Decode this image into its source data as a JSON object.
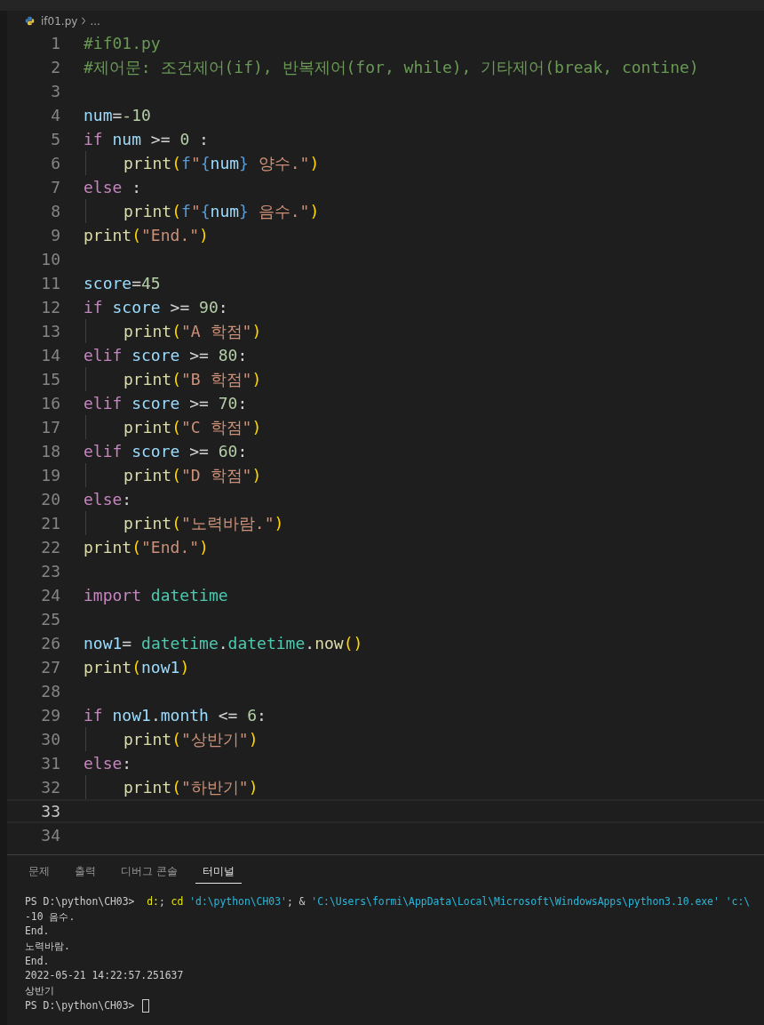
{
  "breadcrumb": {
    "file": "if01.py",
    "more": "..."
  },
  "code_lines": [
    {
      "number": "1",
      "indented": false,
      "current": false,
      "tokens": [
        {
          "kind": "comment",
          "text": "#if01.py"
        }
      ]
    },
    {
      "number": "2",
      "indented": false,
      "current": false,
      "tokens": [
        {
          "kind": "comment",
          "text": "#제어문: 조건제어(if), 반복제어(for, while), 기타제어(break, contine)"
        }
      ]
    },
    {
      "number": "3",
      "indented": false,
      "current": false
    },
    {
      "number": "4",
      "indented": false,
      "current": false,
      "tokens": [
        {
          "kind": "var",
          "text": "num"
        },
        {
          "kind": "op",
          "text": "="
        },
        {
          "kind": "num",
          "text": "-10"
        }
      ]
    },
    {
      "number": "5",
      "indented": false,
      "current": false,
      "tokens": [
        {
          "kind": "kw",
          "text": "if "
        },
        {
          "kind": "var",
          "text": "num"
        },
        {
          "kind": "op",
          "text": " >= "
        },
        {
          "kind": "num",
          "text": "0"
        },
        {
          "kind": "op",
          "text": " :"
        }
      ]
    },
    {
      "number": "6",
      "indented": true,
      "current": false,
      "tokens": [
        {
          "kind": "func",
          "text": "print"
        },
        {
          "kind": "brace",
          "text": "("
        },
        {
          "kind": "fprefix",
          "text": "f"
        },
        {
          "kind": "str",
          "text": "\""
        },
        {
          "kind": "fprefix",
          "text": "{"
        },
        {
          "kind": "var",
          "text": "num"
        },
        {
          "kind": "fprefix",
          "text": "}"
        },
        {
          "kind": "str",
          "text": " 양수.\""
        },
        {
          "kind": "brace",
          "text": ")"
        }
      ]
    },
    {
      "number": "7",
      "indented": false,
      "current": false,
      "tokens": [
        {
          "kind": "kw",
          "text": "else"
        },
        {
          "kind": "op",
          "text": " :"
        }
      ]
    },
    {
      "number": "8",
      "indented": true,
      "current": false,
      "tokens": [
        {
          "kind": "func",
          "text": "print"
        },
        {
          "kind": "brace",
          "text": "("
        },
        {
          "kind": "fprefix",
          "text": "f"
        },
        {
          "kind": "str",
          "text": "\""
        },
        {
          "kind": "fprefix",
          "text": "{"
        },
        {
          "kind": "var",
          "text": "num"
        },
        {
          "kind": "fprefix",
          "text": "}"
        },
        {
          "kind": "str",
          "text": " 음수.\""
        },
        {
          "kind": "brace",
          "text": ")"
        }
      ]
    },
    {
      "number": "9",
      "indented": false,
      "current": false,
      "tokens": [
        {
          "kind": "func",
          "text": "print"
        },
        {
          "kind": "brace",
          "text": "("
        },
        {
          "kind": "str",
          "text": "\"End.\""
        },
        {
          "kind": "brace",
          "text": ")"
        }
      ]
    },
    {
      "number": "10",
      "indented": false,
      "current": false
    },
    {
      "number": "11",
      "indented": false,
      "current": false,
      "tokens": [
        {
          "kind": "var",
          "text": "score"
        },
        {
          "kind": "op",
          "text": "="
        },
        {
          "kind": "num",
          "text": "45"
        }
      ]
    },
    {
      "number": "12",
      "indented": false,
      "current": false,
      "tokens": [
        {
          "kind": "kw",
          "text": "if "
        },
        {
          "kind": "var",
          "text": "score"
        },
        {
          "kind": "op",
          "text": " >= "
        },
        {
          "kind": "num",
          "text": "90"
        },
        {
          "kind": "op",
          "text": ":"
        }
      ]
    },
    {
      "number": "13",
      "indented": true,
      "current": false,
      "tokens": [
        {
          "kind": "func",
          "text": "print"
        },
        {
          "kind": "brace",
          "text": "("
        },
        {
          "kind": "str",
          "text": "\"A 학점\""
        },
        {
          "kind": "brace",
          "text": ")"
        }
      ]
    },
    {
      "number": "14",
      "indented": false,
      "current": false,
      "tokens": [
        {
          "kind": "kw",
          "text": "elif "
        },
        {
          "kind": "var",
          "text": "score"
        },
        {
          "kind": "op",
          "text": " >= "
        },
        {
          "kind": "num",
          "text": "80"
        },
        {
          "kind": "op",
          "text": ":"
        }
      ]
    },
    {
      "number": "15",
      "indented": true,
      "current": false,
      "tokens": [
        {
          "kind": "func",
          "text": "print"
        },
        {
          "kind": "brace",
          "text": "("
        },
        {
          "kind": "str",
          "text": "\"B 학점\""
        },
        {
          "kind": "brace",
          "text": ")"
        }
      ]
    },
    {
      "number": "16",
      "indented": false,
      "current": false,
      "tokens": [
        {
          "kind": "kw",
          "text": "elif "
        },
        {
          "kind": "var",
          "text": "score"
        },
        {
          "kind": "op",
          "text": " >= "
        },
        {
          "kind": "num",
          "text": "70"
        },
        {
          "kind": "op",
          "text": ":"
        }
      ]
    },
    {
      "number": "17",
      "indented": true,
      "current": false,
      "tokens": [
        {
          "kind": "func",
          "text": "print"
        },
        {
          "kind": "brace",
          "text": "("
        },
        {
          "kind": "str",
          "text": "\"C 학점\""
        },
        {
          "kind": "brace",
          "text": ")"
        }
      ]
    },
    {
      "number": "18",
      "indented": false,
      "current": false,
      "tokens": [
        {
          "kind": "kw",
          "text": "elif "
        },
        {
          "kind": "var",
          "text": "score"
        },
        {
          "kind": "op",
          "text": " >= "
        },
        {
          "kind": "num",
          "text": "60"
        },
        {
          "kind": "op",
          "text": ":"
        }
      ]
    },
    {
      "number": "19",
      "indented": true,
      "current": false,
      "tokens": [
        {
          "kind": "func",
          "text": "print"
        },
        {
          "kind": "brace",
          "text": "("
        },
        {
          "kind": "str",
          "text": "\"D 학점\""
        },
        {
          "kind": "brace",
          "text": ")"
        }
      ]
    },
    {
      "number": "20",
      "indented": false,
      "current": false,
      "tokens": [
        {
          "kind": "kw",
          "text": "else"
        },
        {
          "kind": "op",
          "text": ":"
        }
      ]
    },
    {
      "number": "21",
      "indented": true,
      "current": false,
      "tokens": [
        {
          "kind": "func",
          "text": "print"
        },
        {
          "kind": "brace",
          "text": "("
        },
        {
          "kind": "str",
          "text": "\"노력바람.\""
        },
        {
          "kind": "brace",
          "text": ")"
        }
      ]
    },
    {
      "number": "22",
      "indented": false,
      "current": false,
      "tokens": [
        {
          "kind": "func",
          "text": "print"
        },
        {
          "kind": "brace",
          "text": "("
        },
        {
          "kind": "str",
          "text": "\"End.\""
        },
        {
          "kind": "brace",
          "text": ")"
        }
      ]
    },
    {
      "number": "23",
      "indented": false,
      "current": false
    },
    {
      "number": "24",
      "indented": false,
      "current": false,
      "tokens": [
        {
          "kind": "kw",
          "text": "import "
        },
        {
          "kind": "module",
          "text": "datetime"
        }
      ]
    },
    {
      "number": "25",
      "indented": false,
      "current": false
    },
    {
      "number": "26",
      "indented": false,
      "current": false,
      "tokens": [
        {
          "kind": "var",
          "text": "now1"
        },
        {
          "kind": "op",
          "text": "= "
        },
        {
          "kind": "module",
          "text": "datetime"
        },
        {
          "kind": "op",
          "text": "."
        },
        {
          "kind": "module",
          "text": "datetime"
        },
        {
          "kind": "op",
          "text": "."
        },
        {
          "kind": "func",
          "text": "now"
        },
        {
          "kind": "brace",
          "text": "()"
        }
      ]
    },
    {
      "number": "27",
      "indented": false,
      "current": false,
      "tokens": [
        {
          "kind": "func",
          "text": "print"
        },
        {
          "kind": "brace",
          "text": "("
        },
        {
          "kind": "var",
          "text": "now1"
        },
        {
          "kind": "brace",
          "text": ")"
        }
      ]
    },
    {
      "number": "28",
      "indented": false,
      "current": false
    },
    {
      "number": "29",
      "indented": false,
      "current": false,
      "tokens": [
        {
          "kind": "kw",
          "text": "if "
        },
        {
          "kind": "var",
          "text": "now1"
        },
        {
          "kind": "op",
          "text": "."
        },
        {
          "kind": "var",
          "text": "month"
        },
        {
          "kind": "op",
          "text": " <= "
        },
        {
          "kind": "num",
          "text": "6"
        },
        {
          "kind": "op",
          "text": ":"
        }
      ]
    },
    {
      "number": "30",
      "indented": true,
      "current": false,
      "tokens": [
        {
          "kind": "func",
          "text": "print"
        },
        {
          "kind": "brace",
          "text": "("
        },
        {
          "kind": "str",
          "text": "\"상반기\""
        },
        {
          "kind": "brace",
          "text": ")"
        }
      ]
    },
    {
      "number": "31",
      "indented": false,
      "current": false,
      "tokens": [
        {
          "kind": "kw",
          "text": "else"
        },
        {
          "kind": "op",
          "text": ":"
        }
      ]
    },
    {
      "number": "32",
      "indented": true,
      "current": false,
      "tokens": [
        {
          "kind": "func",
          "text": "print"
        },
        {
          "kind": "brace",
          "text": "("
        },
        {
          "kind": "str",
          "text": "\"하반기\""
        },
        {
          "kind": "brace",
          "text": ")"
        }
      ]
    },
    {
      "number": "33",
      "indented": false,
      "current": true
    },
    {
      "number": "34",
      "indented": false,
      "current": false
    }
  ],
  "panel_tabs": [
    {
      "label": "문제",
      "selected": false
    },
    {
      "label": "출력",
      "selected": false
    },
    {
      "label": "디버그 콘솔",
      "selected": false
    },
    {
      "label": "터미널",
      "selected": true
    }
  ],
  "terminal_lines": [
    {
      "tokens": [
        {
          "kind": "plain",
          "text": "PS D:\\python\\CH03>  "
        },
        {
          "kind": "cmd",
          "text": "d:"
        },
        {
          "kind": "plain",
          "text": "; "
        },
        {
          "kind": "cmd",
          "text": "cd "
        },
        {
          "kind": "arg",
          "text": "'d:\\python\\CH03'"
        },
        {
          "kind": "plain",
          "text": "; & "
        },
        {
          "kind": "arg",
          "text": "'C:\\Users\\formi\\AppData\\Local\\Microsoft\\WindowsApps\\python3.10.exe'"
        },
        {
          "kind": "arg",
          "text": " 'c:\\"
        }
      ],
      "cursor": false
    },
    {
      "tokens": [
        {
          "kind": "plain",
          "text": "-10 음수."
        }
      ],
      "cursor": false
    },
    {
      "tokens": [
        {
          "kind": "plain",
          "text": "End."
        }
      ],
      "cursor": false
    },
    {
      "tokens": [
        {
          "kind": "plain",
          "text": "노력바람."
        }
      ],
      "cursor": false
    },
    {
      "tokens": [
        {
          "kind": "plain",
          "text": "End."
        }
      ],
      "cursor": false
    },
    {
      "tokens": [
        {
          "kind": "plain",
          "text": "2022-05-21 14:22:57.251637"
        }
      ],
      "cursor": false
    },
    {
      "tokens": [
        {
          "kind": "plain",
          "text": "상반기"
        }
      ],
      "cursor": false
    },
    {
      "tokens": [
        {
          "kind": "plain",
          "text": "PS D:\\python\\CH03> "
        }
      ],
      "cursor": true
    }
  ]
}
